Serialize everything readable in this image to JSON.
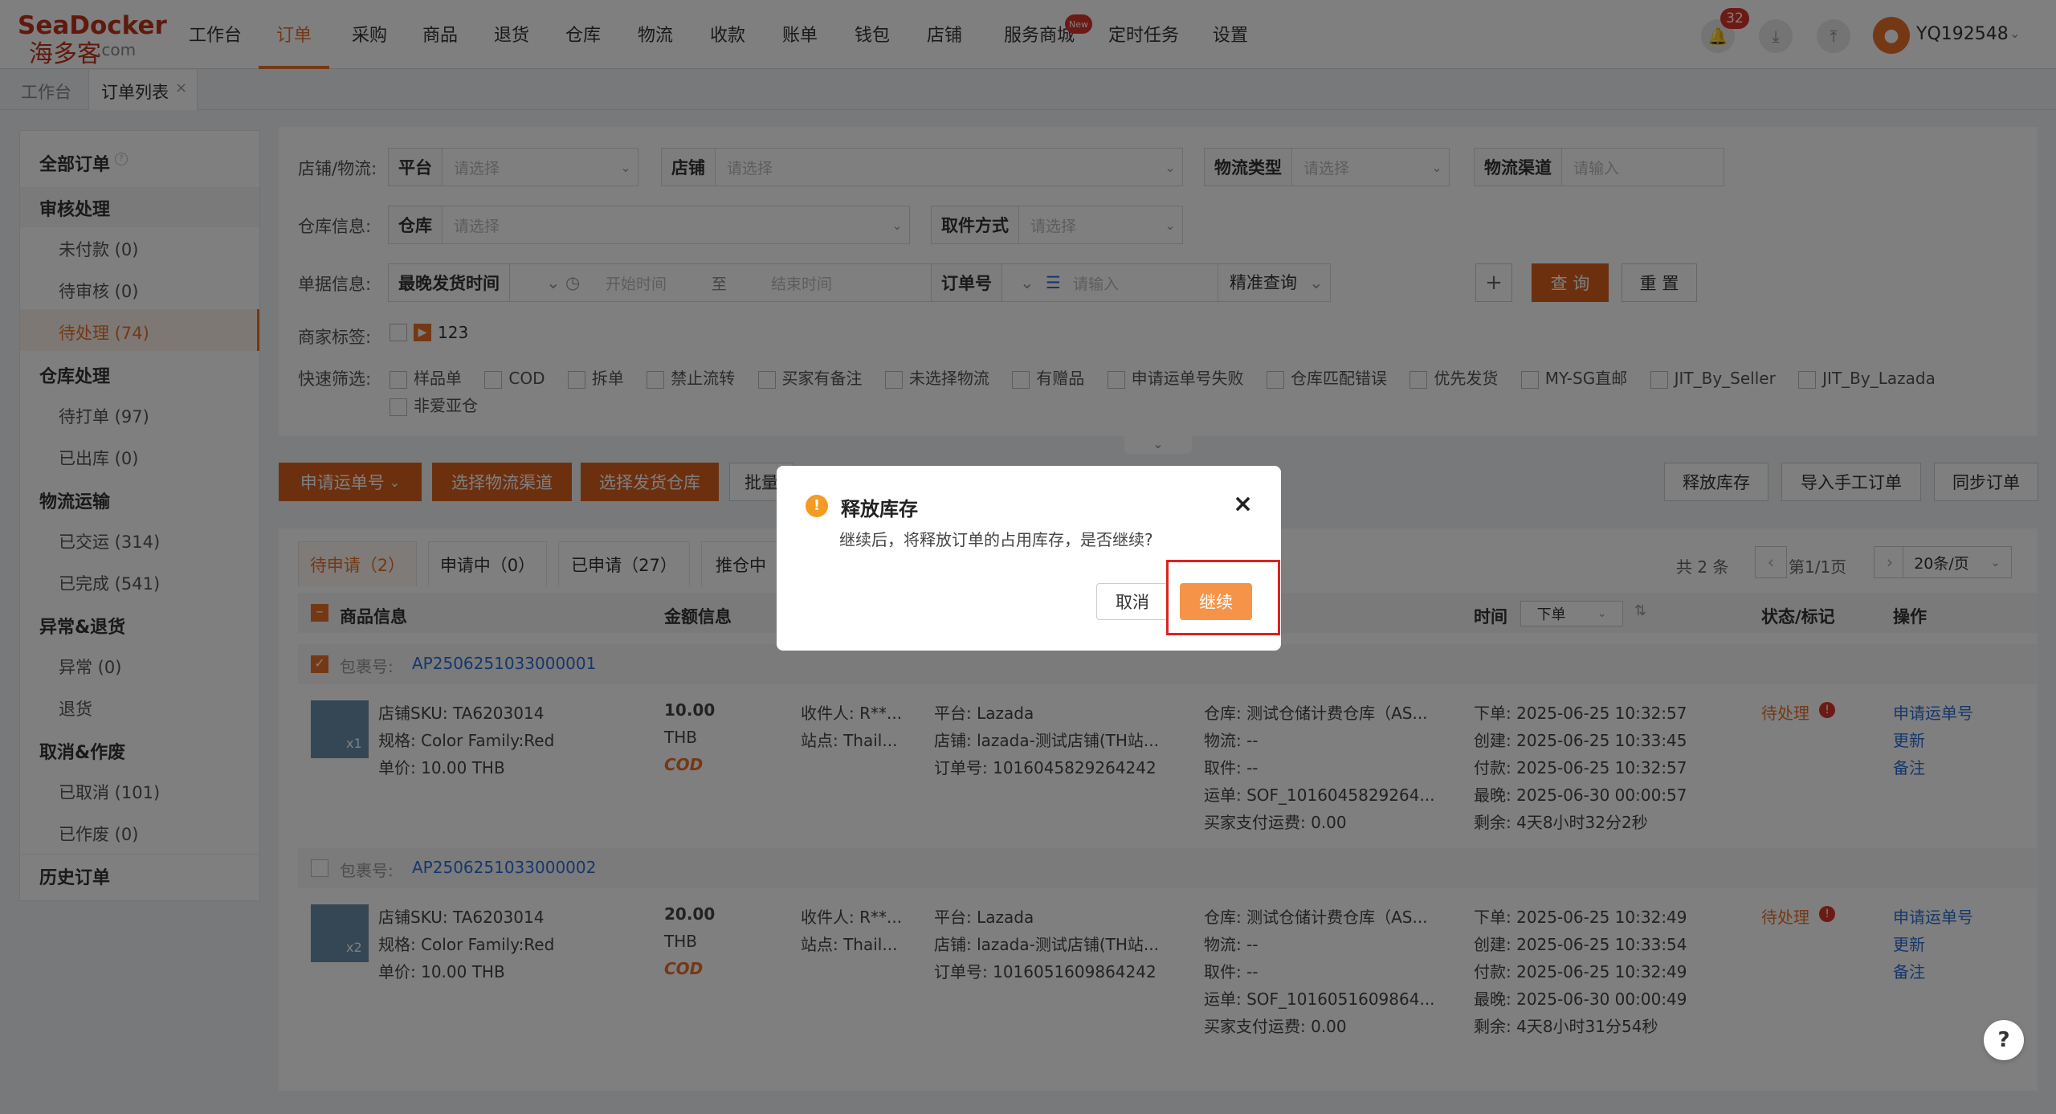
{
  "logo": {
    "brand": "SeaDocker",
    "cn": "海多客",
    "suffix": ".com"
  },
  "nav": [
    "工作台",
    "订单",
    "采购",
    "商品",
    "退货",
    "仓库",
    "物流",
    "收款",
    "账单",
    "钱包",
    "店铺",
    "服务商城",
    "定时任务",
    "设置"
  ],
  "nav_active": "订单",
  "nav_badge": "New",
  "header": {
    "notif_count": "32",
    "username": "YQ192548"
  },
  "tabs": [
    "工作台",
    "订单列表"
  ],
  "sidebar": {
    "all": "全部订单",
    "g1": "审核处理",
    "g1_items": [
      "未付款 (0)",
      "待审核 (0)",
      "待处理 (74)"
    ],
    "g2": "仓库处理",
    "g2_items": [
      "待打单 (97)",
      "已出库 (0)"
    ],
    "g3": "物流运输",
    "g3_items": [
      "已交运 (314)",
      "已完成 (541)"
    ],
    "g4": "异常&退货",
    "g4_items": [
      "异常 (0)",
      "退货"
    ],
    "g5": "取消&作废",
    "g5_items": [
      "已取消 (101)",
      "已作废 (0)"
    ],
    "history": "历史订单"
  },
  "filter": {
    "l_store": "店铺/物流:",
    "platform": "平台",
    "platform_ph": "请选择",
    "store": "店铺",
    "store_ph": "请选择",
    "ltype": "物流类型",
    "ltype_ph": "请选择",
    "lchan": "物流渠道",
    "lchan_ph": "请输入",
    "l_wh": "仓库信息:",
    "wh": "仓库",
    "wh_ph": "请选择",
    "pick": "取件方式",
    "pick_ph": "请选择",
    "l_doc": "单据信息:",
    "time_sel": "最晚发货时间",
    "start": "开始时间",
    "to": "至",
    "end": "结束时间",
    "order_no": "订单号",
    "order_ph": "请输入",
    "precise": "精准查询",
    "query": "查 询",
    "reset": "重 置",
    "l_tag": "商家标签:",
    "tag_val": "123",
    "l_quick": "快速筛选:",
    "quick": [
      "样品单",
      "COD",
      "拆单",
      "禁止流转",
      "买家有备注",
      "未选择物流",
      "有赠品",
      "申请运单号失败",
      "仓库匹配错误",
      "优先发货",
      "MY-SG直邮",
      "JIT_By_Seller",
      "JIT_By_Lazada",
      "非爱亚仓"
    ]
  },
  "actions": {
    "apply_waybill": "申请运单号",
    "choose_channel": "选择物流渠道",
    "choose_wh": "选择发货仓库",
    "batch": "批量",
    "release": "释放库存",
    "import": "导入手工订单",
    "sync": "同步订单"
  },
  "subtabs": [
    "待申请（2）",
    "申请中（0）",
    "已申请（27）",
    "推仓中（"
  ],
  "pager": {
    "total": "共 2 条",
    "page": "第1/1页",
    "size": "20条/页"
  },
  "cols": {
    "goods": "商品信息",
    "amount": "金额信息",
    "time": "时间",
    "time_sel": "下单",
    "status": "状态/标记",
    "op": "操作"
  },
  "rows": [
    {
      "pkg_label": "包裹号:",
      "pkg": "AP2506251033000001",
      "sku": "店铺SKU: TA6203014",
      "spec": "规格: Color Family:Red",
      "unit": "单价: 10.00 THB",
      "qty": "x1",
      "amount": "10.00",
      "cur": "THB",
      "cod": "COD",
      "rcv": "收件人: R**...",
      "site": "站点: Thail...",
      "plat": "平台: Lazada",
      "shop": "店铺: lazada-测试店铺(TH站...",
      "ord": "订单号: 1016045829264242",
      "wh": "仓库: 测试仓储计费仓库（AS...",
      "lg": "物流: --",
      "pk": "取件: --",
      "wb": "运单: SOF_1016045829264...",
      "fee": "买家支付运费: 0.00",
      "t1": "下单: 2025-06-25 10:32:57",
      "t2": "创建: 2025-06-25 10:33:45",
      "t3": "付款: 2025-06-25 10:32:57",
      "t4": "最晚: 2025-06-30 00:00:57",
      "t5": "剩余: 4天8小时32分2秒",
      "status": "待处理",
      "ops": [
        "申请运单号",
        "更新",
        "备注"
      ]
    },
    {
      "pkg_label": "包裹号:",
      "pkg": "AP2506251033000002",
      "sku": "店铺SKU: TA6203014",
      "spec": "规格: Color Family:Red",
      "unit": "单价: 10.00 THB",
      "qty": "x2",
      "amount": "20.00",
      "cur": "THB",
      "cod": "COD",
      "rcv": "收件人: R**...",
      "site": "站点: Thail...",
      "plat": "平台: Lazada",
      "shop": "店铺: lazada-测试店铺(TH站...",
      "ord": "订单号: 1016051609864242",
      "wh": "仓库: 测试仓储计费仓库（AS...",
      "lg": "物流: --",
      "pk": "取件: --",
      "wb": "运单: SOF_1016051609864...",
      "fee": "买家支付运费: 0.00",
      "t1": "下单: 2025-06-25 10:32:49",
      "t2": "创建: 2025-06-25 10:33:54",
      "t3": "付款: 2025-06-25 10:32:49",
      "t4": "最晚: 2025-06-30 00:00:49",
      "t5": "剩余: 4天8小时31分54秒",
      "status": "待处理",
      "ops": [
        "申请运单号",
        "更新",
        "备注"
      ]
    }
  ],
  "modal": {
    "title": "释放库存",
    "msg": "继续后，将释放订单的占用库存，是否继续?",
    "cancel": "取消",
    "confirm": "继续"
  },
  "help": "?"
}
